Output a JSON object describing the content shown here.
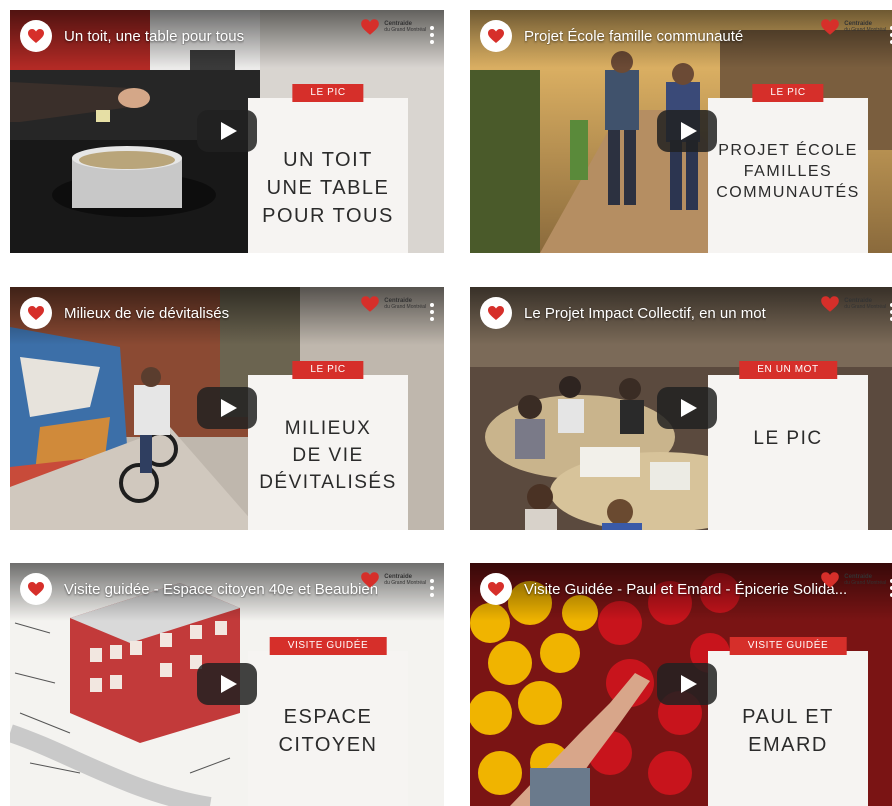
{
  "videos": [
    {
      "title": "Un toit, une table pour tous",
      "badge": "LE PIC",
      "panel_title": "UN TOIT\nUNE TABLE\nPOUR TOUS"
    },
    {
      "title": "Projet École famille communauté",
      "badge": "LE PIC",
      "panel_title": "PROJET ÉCOLE\nFAMILLES\nCOMMUNAUTÉS"
    },
    {
      "title": "Milieux de vie dévitalisés",
      "badge": "LE PIC",
      "panel_title": "MILIEUX\nDE VIE\nDÉVITALISÉS"
    },
    {
      "title": "Le Projet Impact Collectif, en un mot",
      "badge": "EN UN MOT",
      "panel_title": "LE PIC"
    },
    {
      "title": "Visite guidée - Espace citoyen 40e et Beaubien",
      "badge": "VISITE GUIDÉE",
      "panel_title": "ESPACE\nCITOYEN"
    },
    {
      "title": "Visite Guidée - Paul et Emard - Épicerie Solida...",
      "badge": "VISITE GUIDÉE",
      "panel_title": "PAUL ET\nEMARD"
    }
  ],
  "logo": {
    "line1": "Centraide",
    "line2": "du Grand Montréal"
  },
  "icons": {
    "channel": "centraide-heart-icon",
    "play": "play-icon",
    "menu": "more-vert-icon"
  },
  "colors": {
    "accent": "#d62f2a",
    "panel": "#f6f4f2"
  }
}
